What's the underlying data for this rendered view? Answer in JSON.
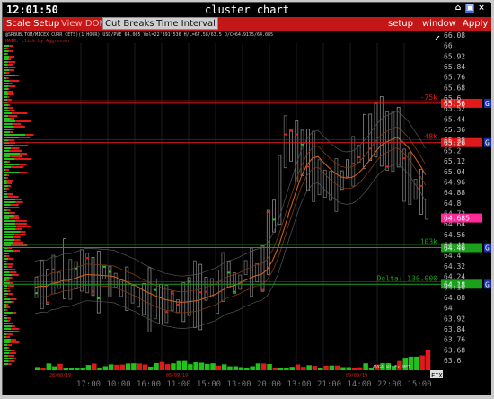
{
  "titlebar": {
    "time": "12:01:50",
    "title": "cluster chart"
  },
  "menu": {
    "scale_setup": "Scale Setup",
    "view_dom": "View DOM",
    "cut_breaks": "Cut Breaks",
    "time_interval": "Time Interval",
    "setup": "setup",
    "window": "window",
    "apply": "Apply"
  },
  "chart": {
    "info_line": "@SRBUB.TOM/MICEX CURR CETS)(1 HOUR) USD/PVE 64.005 Vol=22'391'536 H/L=67.58/63.5 O/C=64.9175/64.085",
    "info_line2": "MAIR: click by Aggressor",
    "levels": [
      {
        "label": "-75k",
        "price": "65.56",
        "color": "#e01a1a"
      },
      {
        "label": "-48k",
        "price": "65.26",
        "color": "#e01a1a"
      },
      {
        "label": "103k",
        "price": "64.46",
        "color": "#1aa01a"
      },
      {
        "label": "Delta: 130.000",
        "price": "64.18",
        "color": "#1aa01a"
      }
    ],
    "current_price": "64.685",
    "g_marker": "G",
    "price_axis": [
      "66.08",
      "66",
      "65.92",
      "65.84",
      "65.76",
      "65.68",
      "65.6",
      "65.52",
      "65.44",
      "65.36",
      "65.28",
      "65.2",
      "65.12",
      "65.04",
      "64.96",
      "64.88",
      "64.8",
      "64.72",
      "64.64",
      "64.56",
      "64.48",
      "64.4",
      "64.32",
      "64.24",
      "64.16",
      "64.08",
      "64",
      "63.92",
      "63.84",
      "63.76",
      "63.68",
      "63.6"
    ],
    "time_axis": [
      "17:00",
      "10:00",
      "16:00",
      "11:00",
      "15:00",
      "13:00",
      "20:00",
      "13:00",
      "21:00",
      "14:00",
      "22:00",
      "15:00"
    ],
    "date_labels": [
      "28/08/19",
      "05/09/19",
      "09/09/19"
    ],
    "fix_label": "FIX",
    "small_label": "AVGA Wt.Ex.MET.."
  },
  "colors": {
    "menu_bg": "#c31616",
    "bid": "#21c21a",
    "ask": "#e01a1a",
    "current": "#ff2a9a",
    "level_red": "#e01a1a",
    "level_green": "#1aa01a"
  }
}
